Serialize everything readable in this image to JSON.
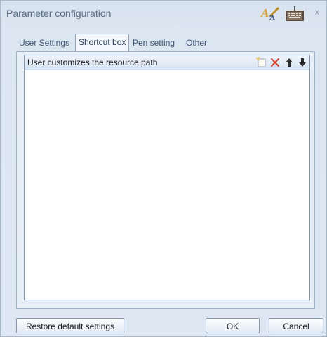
{
  "window": {
    "title": "Parameter configuration",
    "close_glyph": "x",
    "icons": [
      "text-style-icon",
      "keyboard-icon"
    ]
  },
  "tabs": [
    {
      "label": "User Settings",
      "active": false
    },
    {
      "label": "Shortcut box",
      "active": true
    },
    {
      "label": "Pen setting",
      "active": false
    },
    {
      "label": "Other",
      "active": false
    }
  ],
  "list": {
    "header": "User customizes the resource path",
    "tools": [
      "new-item-icon",
      "delete-icon",
      "move-up-icon",
      "move-down-icon"
    ],
    "items": []
  },
  "footer": {
    "restore_label": "Restore default settings",
    "ok_label": "OK",
    "cancel_label": "Cancel"
  },
  "colors": {
    "window_bg": "#dce6f1",
    "title_text": "#5a6b82",
    "delete_red": "#d23a2a",
    "arrow_dark": "#2b2b2b"
  }
}
